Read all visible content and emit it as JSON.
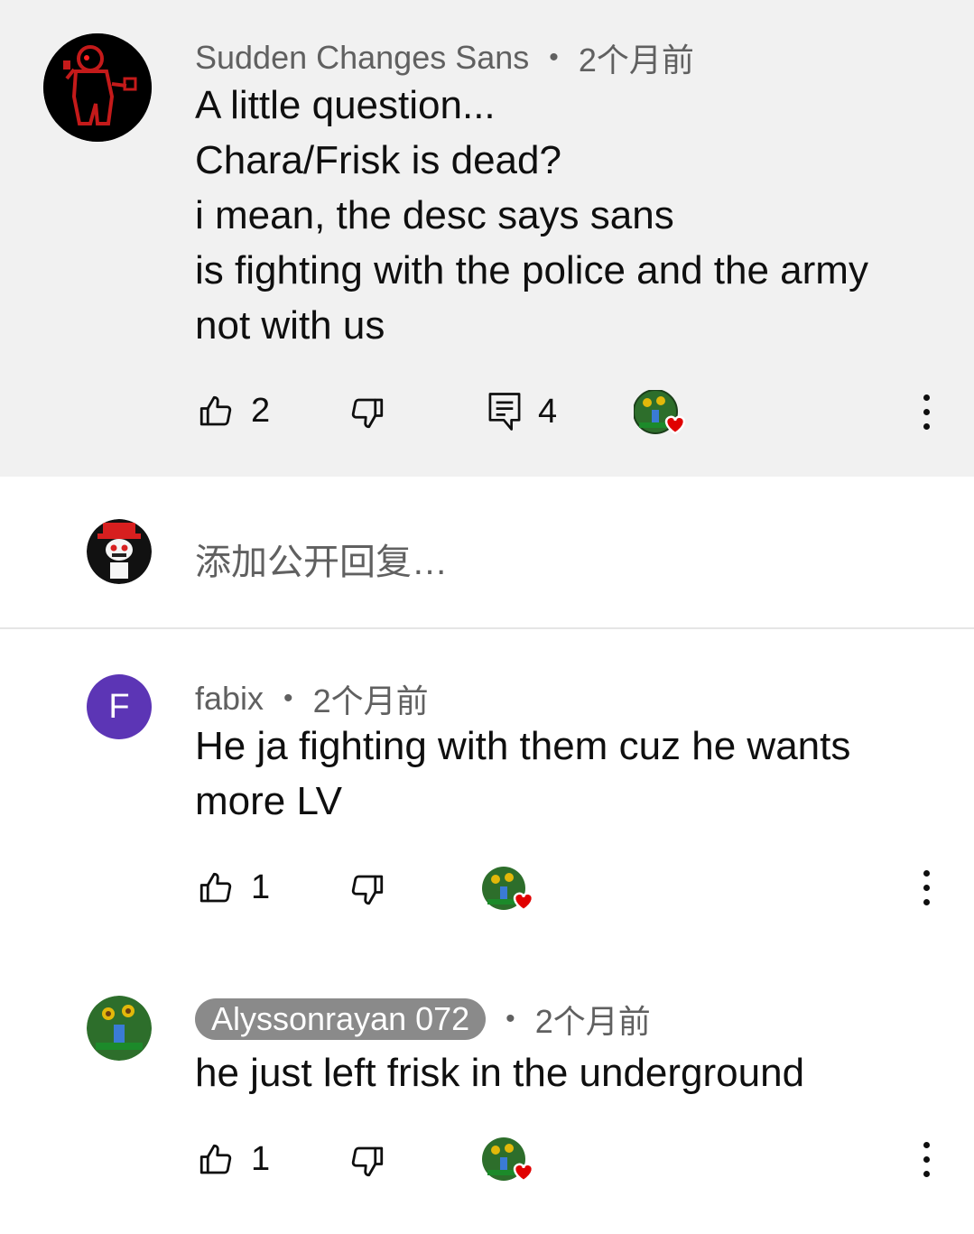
{
  "main_comment": {
    "author": "Sudden Changes Sans",
    "time": "2个月前",
    "lines": [
      "A little question...",
      "Chara/Frisk is dead?",
      "i mean, the desc says sans",
      "is fighting with the police and the army",
      "not with us"
    ],
    "likes": "2",
    "replies": "4"
  },
  "reply_box": {
    "placeholder": "添加公开回复…"
  },
  "replies": [
    {
      "author": "fabix",
      "avatar_letter": "F",
      "time": "2个月前",
      "lines": [
        "He ja fighting with them cuz  he wants",
        "more LV"
      ],
      "likes": "1"
    },
    {
      "author": "Alyssonrayan 072",
      "time": "2个月前",
      "lines": [
        "he just left frisk in the underground"
      ],
      "likes": "1"
    }
  ],
  "icons": {
    "like": "thumbs-up-icon",
    "dislike": "thumbs-down-icon",
    "reply": "comment-icon",
    "more": "more-vertical-icon",
    "creator_heart": "heart-icon"
  },
  "colors": {
    "highlight_bg": "#f1f1f1",
    "heart": "#e00000",
    "fabix_avatar": "#5c35b5"
  }
}
